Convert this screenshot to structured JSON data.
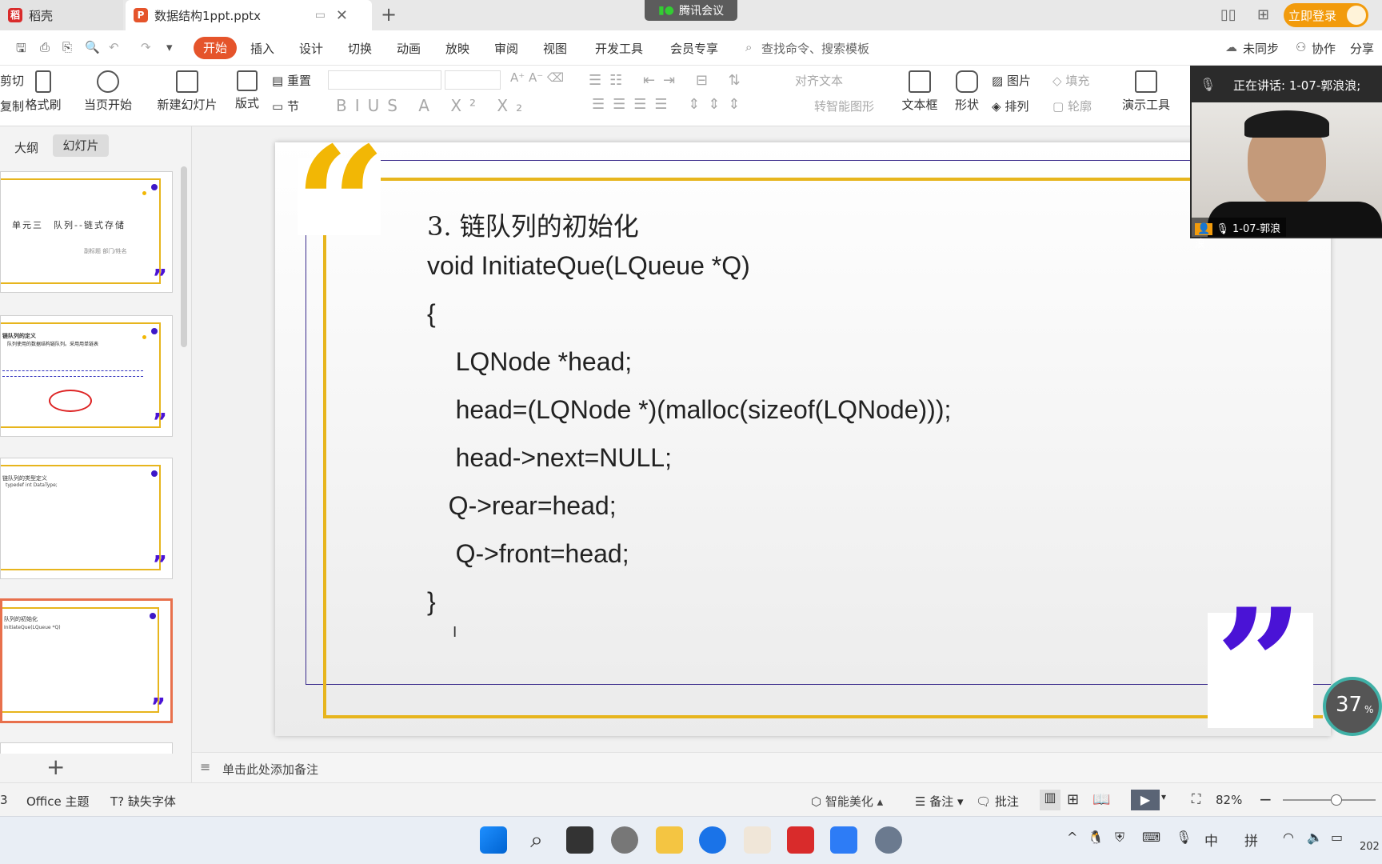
{
  "tabs": [
    {
      "label": "稻壳"
    },
    {
      "label": "数据结构1ppt.pptx"
    }
  ],
  "meeting": {
    "label": "腾讯会议",
    "speaking": "正在讲话: 1-07-郭浪浪;",
    "participant": "1-07-郭浪浪"
  },
  "titlebar": {
    "login": "立即登录"
  },
  "menu": {
    "items": [
      "开始",
      "插入",
      "设计",
      "切换",
      "动画",
      "放映",
      "审阅",
      "视图",
      "开发工具",
      "会员专享"
    ],
    "search_placeholder": "查找命令、搜索模板",
    "sync": "未同步",
    "collab": "协作",
    "share": "分享"
  },
  "toolbar": {
    "cut": "剪切",
    "copy": "复制",
    "format_painter": "格式刷",
    "from_current": "当页开始",
    "new_slide": "新建幻灯片",
    "layout": "版式",
    "reset": "重置",
    "section": "节",
    "align_text": "对齐文本",
    "to_smartart": "转智能图形",
    "textbox": "文本框",
    "shape": "形状",
    "picture": "图片",
    "fill": "填充",
    "arrange": "排列",
    "outline": "轮廓",
    "present_tools": "演示工具"
  },
  "leftpanel": {
    "tab_outline": "大纲",
    "tab_slides": "幻灯片",
    "slides": [
      {
        "title": "单元三　队列--链式存储",
        "sub": "副标题 部门/姓名"
      },
      {
        "title": "链队列的定义",
        "text": "队列使用的数据结构链队列。采用用单链表"
      },
      {
        "title": "链队列的类型定义",
        "text": "typedef int DataType;"
      },
      {
        "title": "队列的初始化",
        "text": "InitiateQue(LQueue *Q)"
      }
    ]
  },
  "slide": {
    "title": "3. 链队列的初始化",
    "code": [
      "void InitiateQue(LQueue *Q)",
      "{",
      "    LQNode *head;",
      "    head=(LQNode *)(malloc(sizeof(LQNode)));",
      "    head->next=NULL;",
      "   Q->rear=head;",
      "    Q->front=head;",
      "}"
    ]
  },
  "notes": {
    "placeholder": "单击此处添加备注"
  },
  "progress": {
    "value": "37",
    "unit": "%"
  },
  "status": {
    "slide_num": "3",
    "theme": "Office 主题",
    "missing_font": "缺失字体",
    "beautify": "智能美化",
    "notes": "备注",
    "comments": "批注",
    "zoom": "82%"
  },
  "taskbar": {
    "ime1": "中",
    "ime2": "拼",
    "clock": "202"
  },
  "colors": {
    "accent": "#e5542b",
    "quote_yellow": "#f2b705",
    "quote_purple": "#4a13d6",
    "border_purple": "#3a2b8c"
  }
}
